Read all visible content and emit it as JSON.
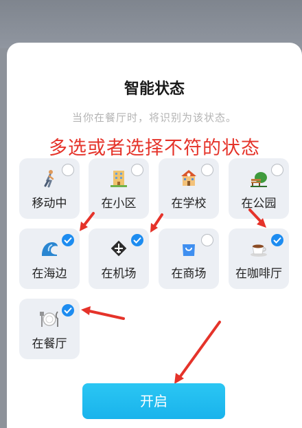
{
  "dialog": {
    "title": "智能状态",
    "subtitle": "当你在餐厅时，将识别为该状态。",
    "annotation": "多选或者选择不符的状态",
    "start_label": "开启"
  },
  "states": [
    {
      "label": "移动中",
      "icon": "walking-person-icon",
      "checked": false
    },
    {
      "label": "在小区",
      "icon": "residential-building-icon",
      "checked": false
    },
    {
      "label": "在学校",
      "icon": "school-icon",
      "checked": false
    },
    {
      "label": "在公园",
      "icon": "park-icon",
      "checked": false
    },
    {
      "label": "在海边",
      "icon": "wave-icon",
      "checked": true
    },
    {
      "label": "在机场",
      "icon": "airport-icon",
      "checked": true
    },
    {
      "label": "在商场",
      "icon": "shopping-bag-icon",
      "checked": false
    },
    {
      "label": "在咖啡厅",
      "icon": "coffee-cup-icon",
      "checked": true
    },
    {
      "label": "在餐厅",
      "icon": "dining-plate-icon",
      "checked": true
    }
  ],
  "colors": {
    "accent": "#1d8cf0",
    "annotation_red": "#e5332a",
    "button": "#19b3ec"
  }
}
